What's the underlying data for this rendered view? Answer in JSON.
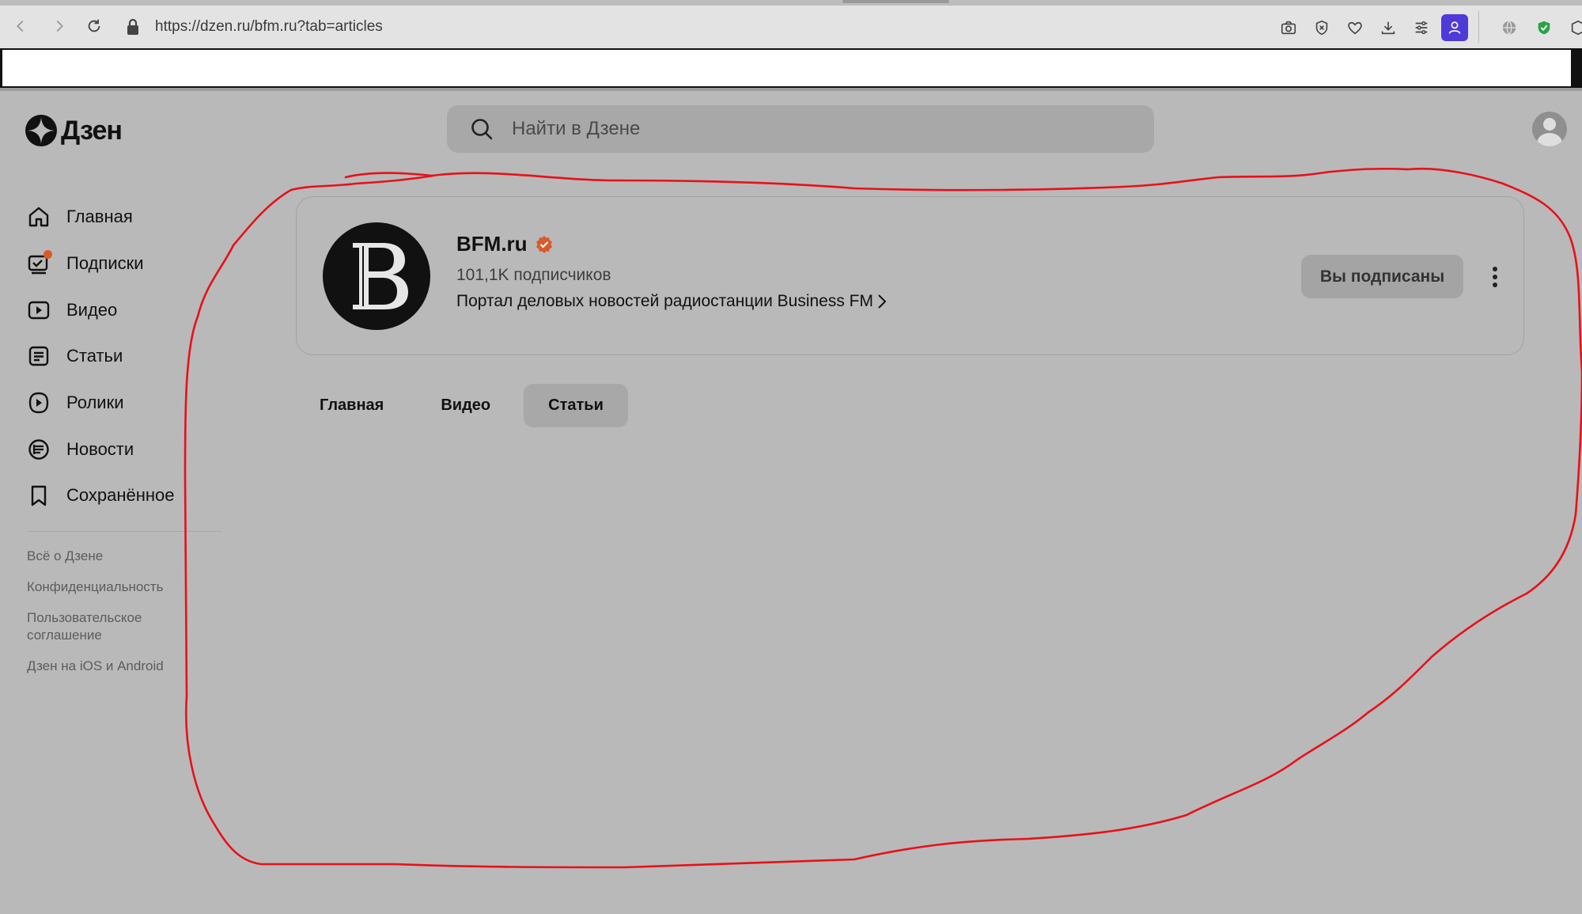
{
  "browser": {
    "url": "https://dzen.ru/bfm.ru?tab=articles",
    "extensions": [
      "camera-icon",
      "shield-x-icon",
      "heart-icon",
      "download-icon",
      "sliders-icon",
      "profile-icon",
      "globe-icon",
      "green-shield-icon",
      "cube-icon"
    ],
    "profile_color": "#4e3ad8"
  },
  "header": {
    "logo_text": "Дзен",
    "search_placeholder": "Найти в Дзене"
  },
  "sidebar": {
    "items": [
      {
        "label": "Главная",
        "icon": "home-icon"
      },
      {
        "label": "Подписки",
        "icon": "subscriptions-icon",
        "notification_dot": true
      },
      {
        "label": "Видео",
        "icon": "video-icon"
      },
      {
        "label": "Статьи",
        "icon": "articles-icon"
      },
      {
        "label": "Ролики",
        "icon": "shorts-icon"
      },
      {
        "label": "Новости",
        "icon": "news-icon"
      },
      {
        "label": "Сохранённое",
        "icon": "bookmark-icon"
      }
    ],
    "footer_links": [
      "Всё о Дзене",
      "Конфиденциальность",
      "Пользовательское соглашение",
      "Дзен на iOS и Android"
    ]
  },
  "channel": {
    "name": "BFM.ru",
    "verified": true,
    "subscribers": "101,1K подписчиков",
    "description": "Портал деловых новостей радиостанции Business FM",
    "subscribe_button": "Вы подписаны",
    "accent_color": "#d85a2a"
  },
  "tabs": [
    {
      "label": "Главная",
      "active": false
    },
    {
      "label": "Видео",
      "active": false
    },
    {
      "label": "Статьи",
      "active": true
    }
  ],
  "annotation": {
    "color": "#e8101a"
  }
}
